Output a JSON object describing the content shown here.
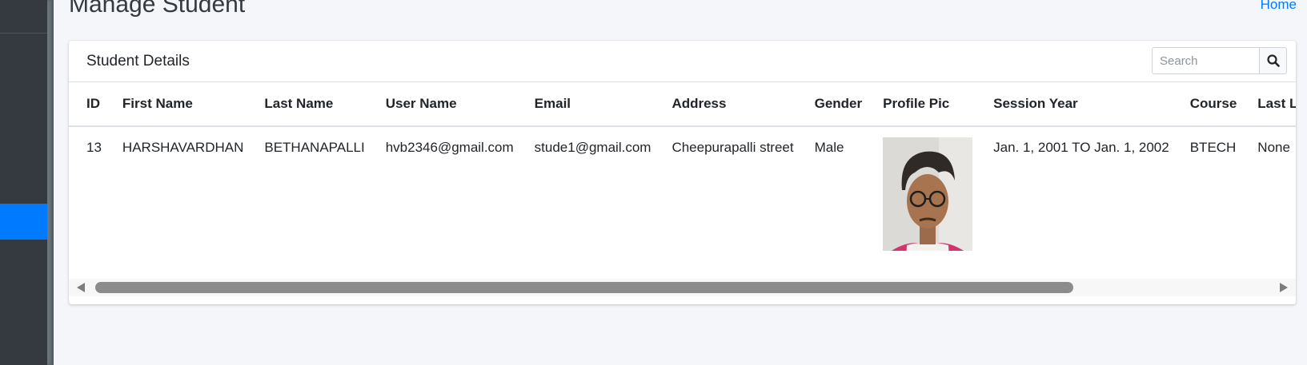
{
  "page": {
    "title": "Manage Student",
    "breadcrumb_home": "Home"
  },
  "card": {
    "title": "Student Details",
    "search_placeholder": "Search"
  },
  "table": {
    "columns": [
      "ID",
      "First Name",
      "Last Name",
      "User Name",
      "Email",
      "Address",
      "Gender",
      "Profile Pic",
      "Session Year",
      "Course",
      "Last Login"
    ],
    "rows": [
      {
        "id": "13",
        "first_name": "HARSHAVARDHAN",
        "last_name": "BETHANAPALLI",
        "user_name": "hvb2346@gmail.com",
        "email": "stude1@gmail.com",
        "address": "Cheepurapalli street",
        "gender": "Male",
        "session_year": "Jan. 1, 2001 TO Jan. 1, 2002",
        "course": "BTECH",
        "last_login": "None"
      }
    ]
  },
  "colors": {
    "sidebar": "#343a40",
    "accent": "#007bff",
    "background": "#f4f6f9"
  },
  "icons": {
    "search": "search-icon",
    "scroll_left": "scroll-left-arrow-icon",
    "scroll_right": "scroll-right-arrow-icon"
  }
}
